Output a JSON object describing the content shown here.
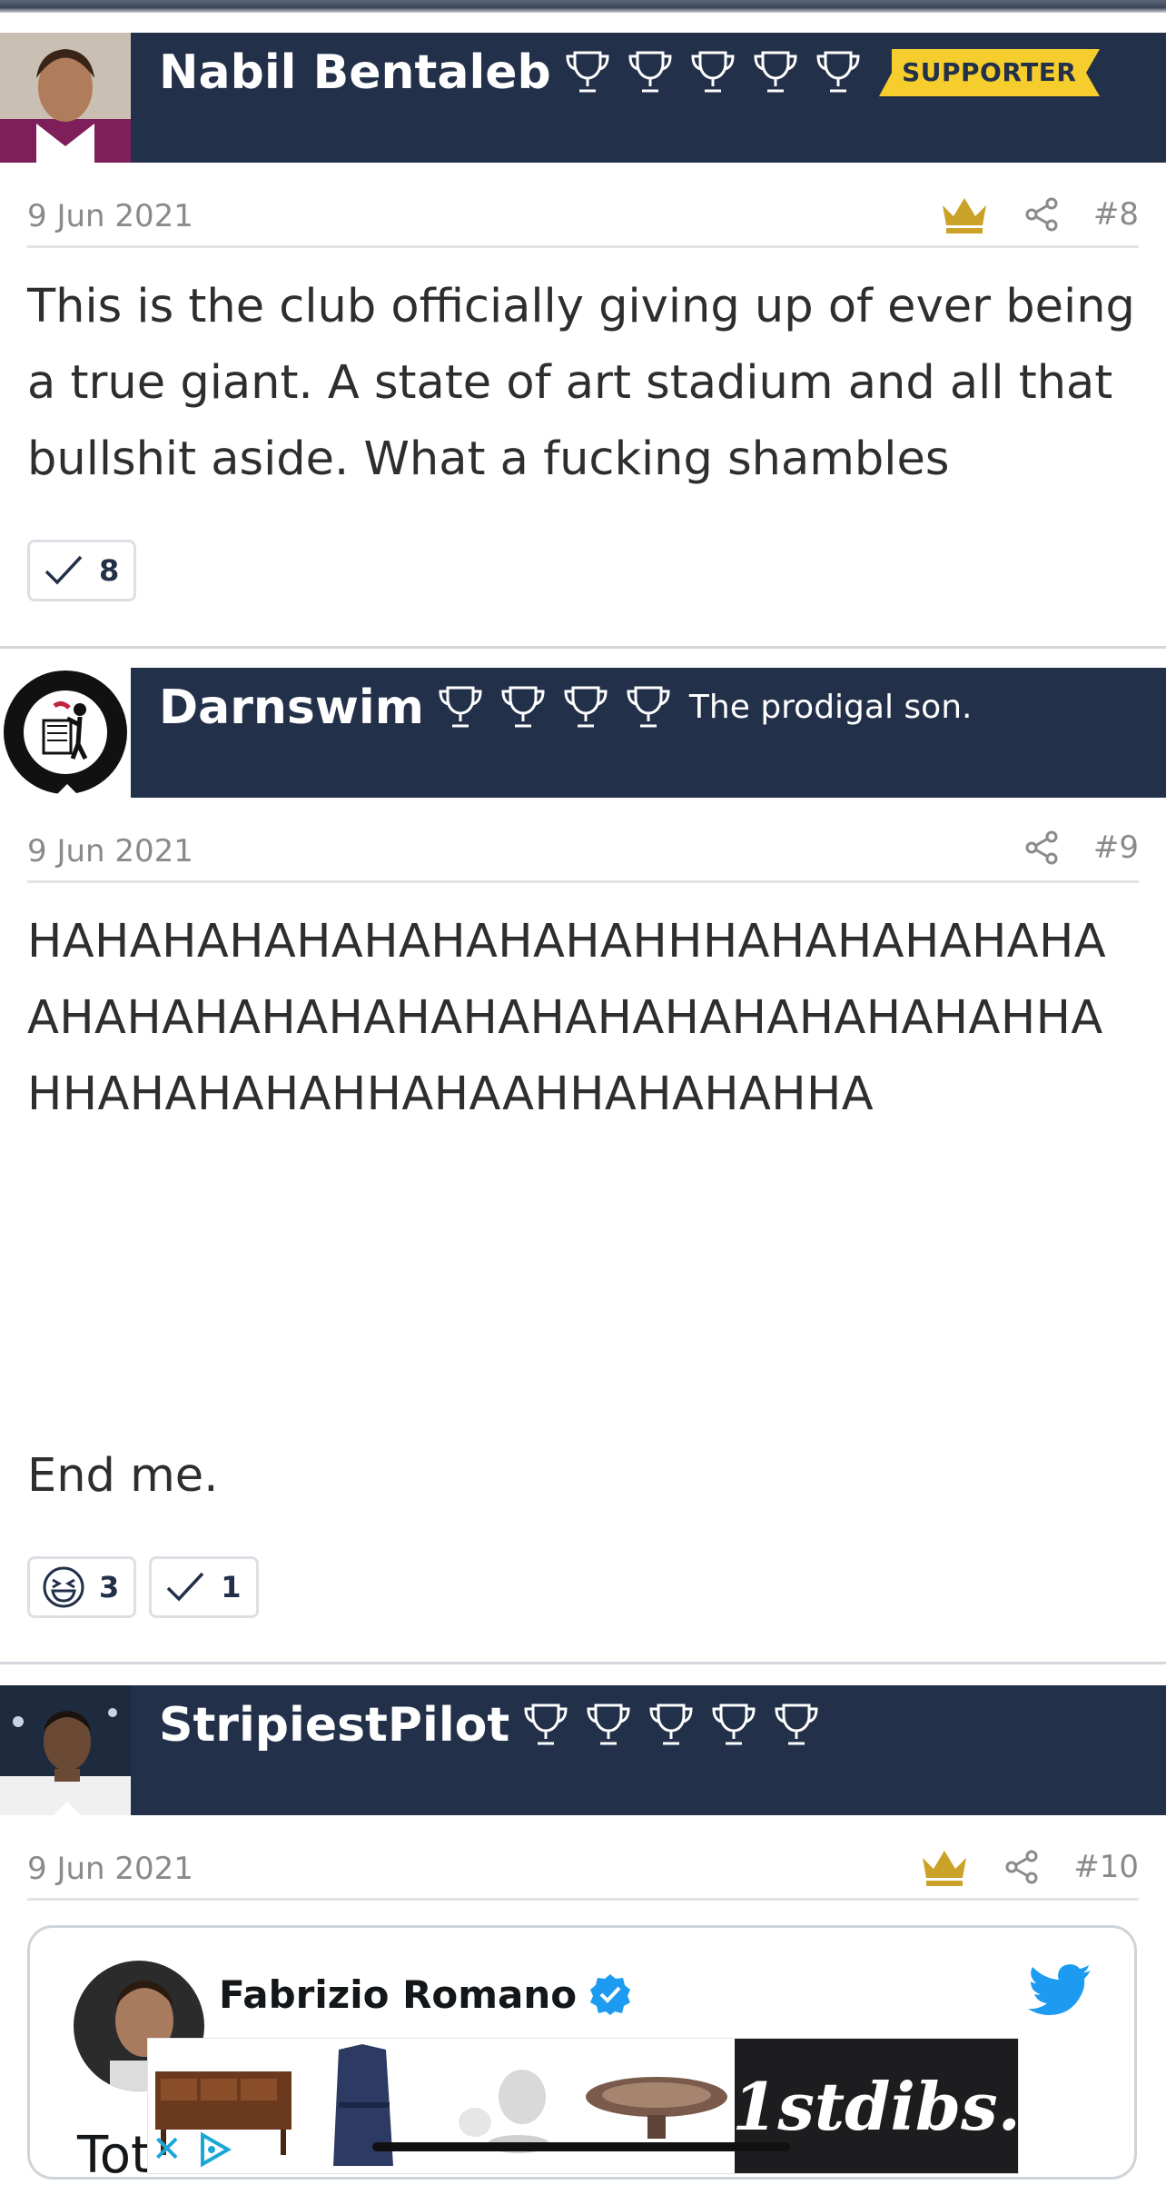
{
  "posts": [
    {
      "username": "Nabil Bentaleb",
      "badge": "SUPPORTER",
      "date": "9 Jun 2021",
      "post_number": "#8",
      "has_crown": true,
      "body": "This is the club officially giving up of ever being a true giant. A state of art stadium and all that bullshit aside. What a fucking shambles",
      "reactions": [
        {
          "icon": "check-icon",
          "count": "8"
        }
      ]
    },
    {
      "username": "Darnswim",
      "user_title": "The prodigal son.",
      "date": "9 Jun 2021",
      "post_number": "#9",
      "has_crown": false,
      "body": "HAHAHAHAHAHAHAHAHAHHHAHAHAHAHAHAAHAHAHAHAHAHAHAHAHAHAHAHAHAHAHHAHHAHAHAHAHHAHAAHHAHAHAHHA",
      "body_end": "End me.",
      "reactions": [
        {
          "icon": "laughing-face-icon",
          "count": "3"
        },
        {
          "icon": "check-icon",
          "count": "1"
        }
      ]
    },
    {
      "username": "StripiestPilot",
      "date": "9 Jun 2021",
      "post_number": "#10",
      "has_crown": true,
      "embed": {
        "author": "Fabrizio Romano",
        "text_start": "Tot"
      }
    }
  ],
  "ad": {
    "brand": "1stdibs."
  },
  "colors": {
    "header_bg": "#233049",
    "gold": "#c9a227",
    "badge": "#f5cd2d",
    "twitter_blue": "#1d9bf0"
  }
}
